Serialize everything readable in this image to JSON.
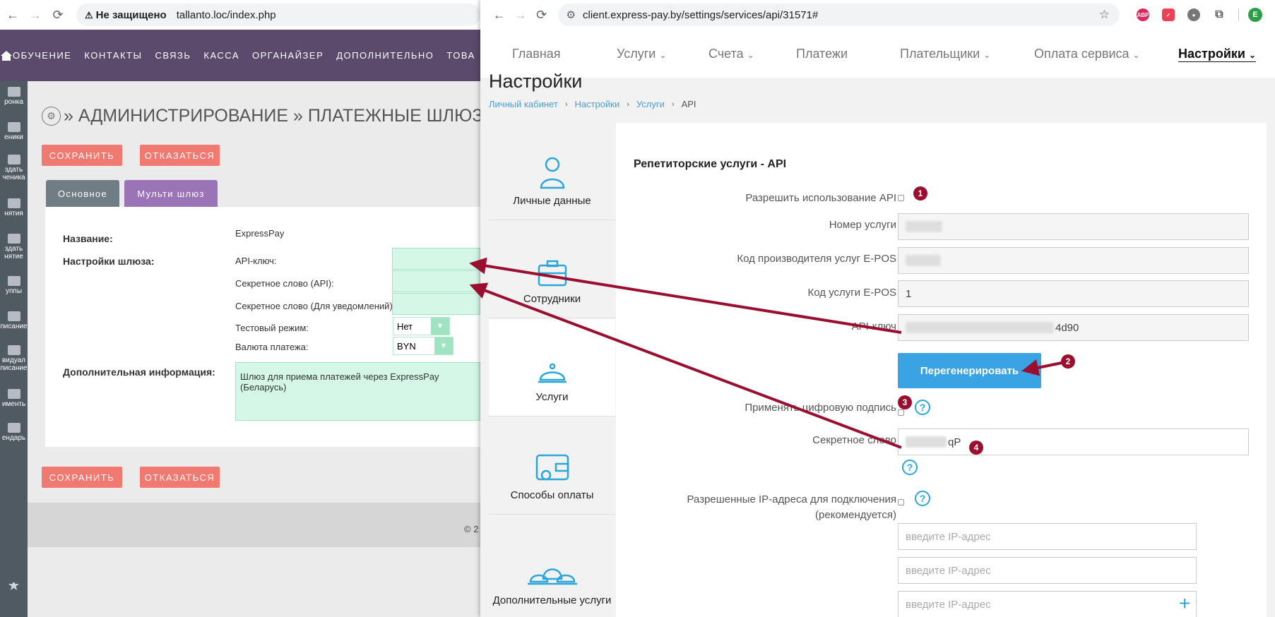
{
  "left_browser": {
    "security_label": "Не защищено",
    "url": "tallanto.loc/index.php"
  },
  "left_app": {
    "nav_items": [
      "ОБУЧЕНИЕ",
      "КОНТАКТЫ",
      "СВЯЗЬ",
      "КАССА",
      "ОРГАНАЙЗЕР",
      "ДОПОЛНИТЕЛЬНО",
      "ТОВА"
    ],
    "sidebar_items": [
      "ронка",
      "еники",
      "здать\nченика",
      "нятия",
      "здать\nнятие",
      "уппы",
      "писание",
      "видуал\nписание",
      "именть",
      "ендарь"
    ],
    "heading": "» АДМИНИСТРИРОВАНИЕ » ПЛАТЕЖНЫЕ ШЛЮЗЫ",
    "save_label": "СОХРАНИТЬ",
    "cancel_label": "ОТКАЗАТЬСЯ",
    "tabs": [
      "Основное",
      "Мульти шлюз"
    ],
    "name_label": "Название:",
    "name_value": "ExpressPay",
    "gateway_label": "Настройки шлюза:",
    "api_key_label": "API-ключ:",
    "secret_api_label": "Секретное слово (API):",
    "secret_notify_label": "Секретное слово (Для уведомлений):",
    "test_mode_label": "Тестовый режим:",
    "test_mode_value": "Нет",
    "currency_label": "Валюта платежа:",
    "currency_value": "BYN",
    "extra_label": "Дополнительная информация:",
    "extra_value": "Шлюз для приема платежей через ExpressPay (Беларусь)",
    "copyright": "© 2"
  },
  "right_browser": {
    "url": "client.express-pay.by/settings/services/api/31571#",
    "profile_letter": "E"
  },
  "right_app": {
    "nav_items": [
      "Главная",
      "Услуги",
      "Счета",
      "Платежи",
      "Плательщики",
      "Оплата сервиса",
      "Настройки"
    ],
    "page_title": "Настройки",
    "breadcrumbs": [
      "Личный кабинет",
      "Настройки",
      "Услуги",
      "API"
    ],
    "side_tabs": [
      "Личные данные",
      "Сотрудники",
      "Услуги",
      "Способы оплаты",
      "Дополнительные услуги"
    ],
    "section_title": "Репетиторские услуги - API",
    "allow_api_label": "Разрешить использование API",
    "service_number_label": "Номер услуги",
    "epos_provider_label": "Код производителя услуг E-POS",
    "epos_service_label": "Код услуги E-POS",
    "epos_service_value": "1",
    "api_key_label": "API-ключ",
    "api_key_tail": "4d90",
    "regenerate_label": "Перегенерировать",
    "digital_sign_label": "Применять цифровую подпись",
    "secret_word_label": "Секретное слово",
    "secret_word_tail": "qP",
    "allowed_ip_label_1": "Разрешенные IP-адреса для подключения",
    "allowed_ip_label_2": "(рекомендуется)",
    "ip_placeholder": "введите IP-адрес",
    "badges": [
      "1",
      "2",
      "3",
      "4"
    ]
  },
  "colors": {
    "left_nav_bg": "#5b4a6b",
    "save_red": "#f07a71",
    "tab_main": "#717d85",
    "tab_multi": "#9b74b8",
    "mint_field": "#d4f7e8",
    "regen_blue": "#3aa3e3",
    "arrow_red": "#9a0f2f"
  }
}
